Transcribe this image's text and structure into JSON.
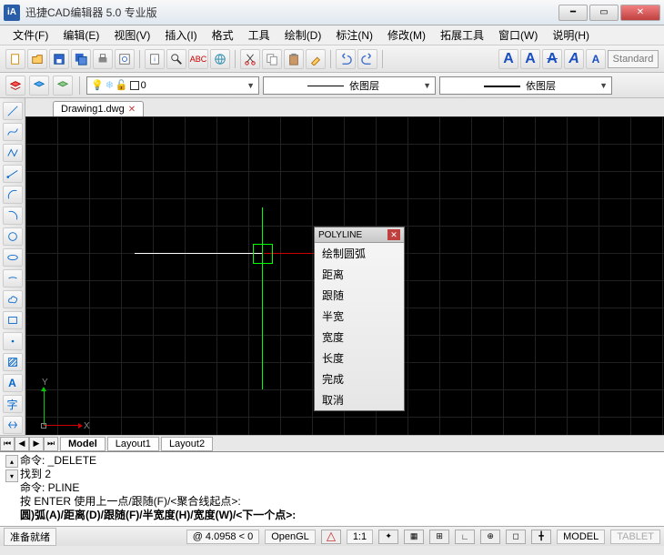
{
  "window": {
    "title": "迅捷CAD编辑器 5.0 专业版",
    "app_icon_text": "iA"
  },
  "menu": {
    "items": [
      {
        "label": "文件(F)"
      },
      {
        "label": "编辑(E)"
      },
      {
        "label": "视图(V)"
      },
      {
        "label": "插入(I)"
      },
      {
        "label": "格式"
      },
      {
        "label": "工具"
      },
      {
        "label": "绘制(D)"
      },
      {
        "label": "标注(N)"
      },
      {
        "label": "修改(M)"
      },
      {
        "label": "拓展工具"
      },
      {
        "label": "窗口(W)"
      },
      {
        "label": "说明(H)"
      }
    ]
  },
  "toolbar1": {
    "standard_label": "Standard"
  },
  "layerbar": {
    "layer_combo": "0",
    "bylayer1": "依图层",
    "bylayer2": "依图层"
  },
  "doc_tab": {
    "label": "Drawing1.dwg"
  },
  "popup": {
    "title": "POLYLINE",
    "items": [
      {
        "label": "绘制圆弧"
      },
      {
        "label": "距离"
      },
      {
        "label": "跟随"
      },
      {
        "label": "半宽"
      },
      {
        "label": "宽度"
      },
      {
        "label": "长度"
      },
      {
        "label": "完成"
      },
      {
        "label": "取消"
      }
    ]
  },
  "bottom_tabs": {
    "tabs": [
      {
        "label": "Model"
      },
      {
        "label": "Layout1"
      },
      {
        "label": "Layout2"
      }
    ]
  },
  "cmd": {
    "lines": [
      "命令: _DELETE",
      "找到  2",
      "命令: PLINE",
      "按 ENTER 使用上一点/跟随(F)/<聚合线起点>:"
    ],
    "prompt": "圆)弧(A)/距离(D)/跟随(F)/半宽度(H)/宽度(W)/<下一个点>:"
  },
  "status": {
    "ready": "准备就绪",
    "coord": "@ 4.0958 < 0",
    "opengl": "OpenGL",
    "scale": "1:1",
    "model": "MODEL",
    "tablet": "TABLET"
  },
  "ucs": {
    "x": "X",
    "y": "Y"
  }
}
